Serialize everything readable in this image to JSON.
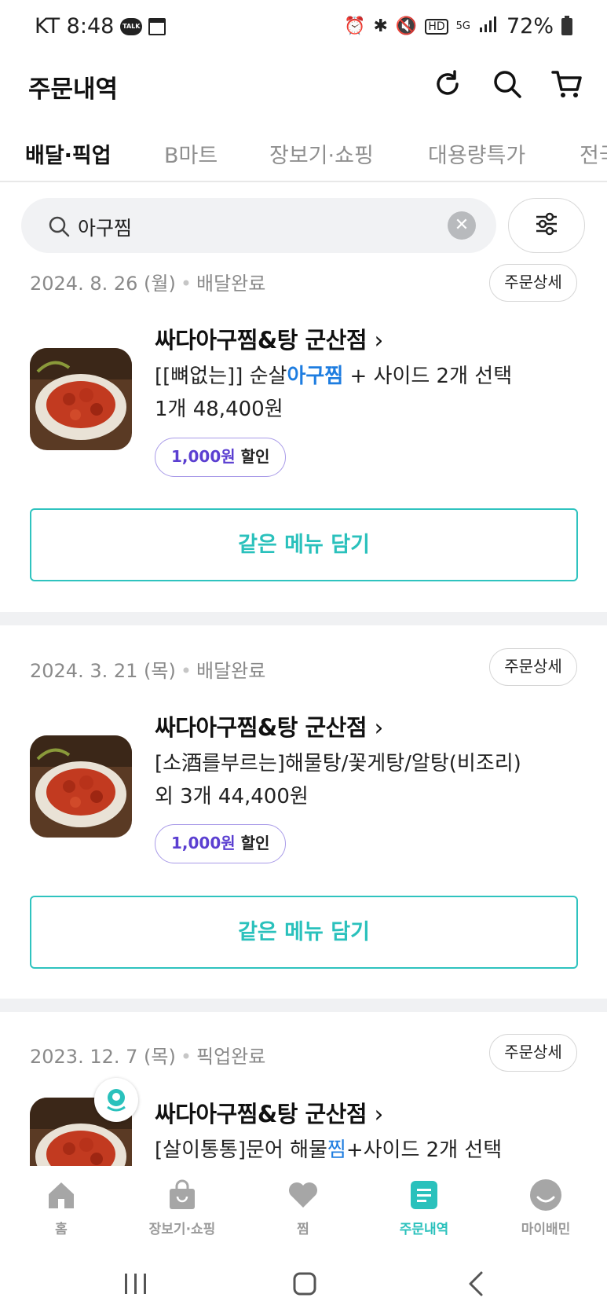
{
  "status_bar": {
    "carrier_time": "KT 8:48",
    "battery": "72%",
    "icons": [
      "kakaotalk-icon",
      "calendar-icon",
      "alarm-icon",
      "bluetooth-icon",
      "mute-icon",
      "hd-icon",
      "5g-icon",
      "signal-icon",
      "battery-icon"
    ]
  },
  "header": {
    "title": "주문내역",
    "icons": [
      "refresh-icon",
      "search-icon",
      "cart-icon"
    ]
  },
  "tabs": [
    "배달·픽업",
    "B마트",
    "장보기·쇼핑",
    "대용량특가",
    "전국"
  ],
  "search": {
    "value": "아구찜"
  },
  "orders": [
    {
      "date": "2024. 8. 26 (월)",
      "status": "배달완료",
      "detail_label": "주문상세",
      "store": "싸다아구찜&탕 군산점",
      "menu_before": "[[뼈없는]] 순살",
      "menu_highlight": "아구찜",
      "menu_after": " + 사이드 2개 선택",
      "quantity_price": "1개 48,400원",
      "discount_amount": "1,000원",
      "discount_label": "할인",
      "add_label": "같은 메뉴 담기"
    },
    {
      "date": "2024. 3. 21 (목)",
      "status": "배달완료",
      "detail_label": "주문상세",
      "store": "싸다아구찜&탕 군산점",
      "menu_line1": "[소酒를부르는]해물탕/꽃게탕/알탕(비조리)",
      "menu_line2": "외 3개 44,400원",
      "discount_amount": "1,000원",
      "discount_label": "할인",
      "add_label": "같은 메뉴 담기"
    },
    {
      "date": "2023. 12. 7 (목)",
      "status": "픽업완료",
      "detail_label": "주문상세",
      "store": "싸다아구찜&탕 군산점",
      "menu_before": "[살이통통]문어 해물",
      "menu_highlight": "찜",
      "menu_after": "+사이드 2개 선택"
    }
  ],
  "bottom_nav": [
    {
      "label": "홈",
      "icon": "home-icon",
      "active": false
    },
    {
      "label": "장보기·쇼핑",
      "icon": "shopping-bag-icon",
      "active": false
    },
    {
      "label": "찜",
      "icon": "heart-icon",
      "active": false
    },
    {
      "label": "주문내역",
      "icon": "order-list-icon",
      "active": true
    },
    {
      "label": "마이배민",
      "icon": "profile-icon",
      "active": false
    }
  ],
  "colors": {
    "accent": "#2ac1bc",
    "highlight": "#1e7de0",
    "discount": "#5b3fd1"
  }
}
